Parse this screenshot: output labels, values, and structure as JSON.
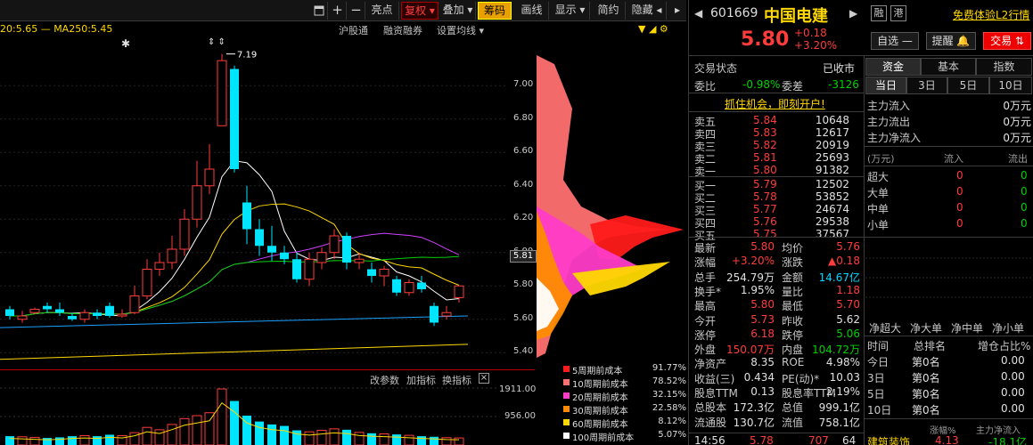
{
  "toolbar": {
    "items": [
      "亮点",
      "复权 ▾",
      "叠加 ▾",
      "筹码",
      "画线",
      "显示 ▾",
      "简约",
      "隐藏 ◂"
    ],
    "icons": [
      "window-icon",
      "plus-icon",
      "minus-icon"
    ]
  },
  "ma_text": "20:5.65 — MA250:5.45",
  "subbar": {
    "items": [
      "沪股通",
      "融资融券",
      "设置均线 ▾"
    ]
  },
  "chart_annotation": "7.19",
  "price_axis": {
    "ticks": [
      "7.00",
      "6.80",
      "6.60",
      "6.40",
      "6.20",
      "6.00",
      "5.80",
      "5.60",
      "5.40"
    ],
    "current": "5.81"
  },
  "indicator_bar": {
    "items": [
      "改参数",
      "加指标",
      "换指标"
    ]
  },
  "volume_axis": {
    "ticks": [
      "1911.00",
      "956.00"
    ]
  },
  "chip_legend": [
    {
      "label": "5周期前成本",
      "value": "91.77%",
      "color": "#ff1a1a"
    },
    {
      "label": "10周期前成本",
      "value": "78.52%",
      "color": "#ff7070"
    },
    {
      "label": "20周期前成本",
      "value": "32.15%",
      "color": "#ff3cc8"
    },
    {
      "label": "30周期前成本",
      "value": "22.58%",
      "color": "#ff8c00"
    },
    {
      "label": "60周期前成本",
      "value": "8.12%",
      "color": "#ffd800"
    },
    {
      "label": "100周期前成本",
      "value": "5.07%",
      "color": "#ffffff"
    }
  ],
  "chart_data": {
    "type": "candlestick",
    "candles": [
      {
        "o": 5.66,
        "c": 5.62,
        "h": 5.68,
        "l": 5.6
      },
      {
        "o": 5.6,
        "c": 5.62,
        "h": 5.65,
        "l": 5.58
      },
      {
        "o": 5.64,
        "c": 5.66,
        "h": 5.67,
        "l": 5.63
      },
      {
        "o": 5.68,
        "c": 5.66,
        "h": 5.7,
        "l": 5.64
      },
      {
        "o": 5.66,
        "c": 5.64,
        "h": 5.7,
        "l": 5.62
      },
      {
        "o": 5.62,
        "c": 5.6,
        "h": 5.64,
        "l": 5.59
      },
      {
        "o": 5.6,
        "c": 5.64,
        "h": 5.66,
        "l": 5.58
      },
      {
        "o": 5.64,
        "c": 5.62,
        "h": 5.66,
        "l": 5.6
      },
      {
        "o": 5.68,
        "c": 5.62,
        "h": 5.7,
        "l": 5.61
      },
      {
        "o": 5.62,
        "c": 5.63,
        "h": 5.66,
        "l": 5.61
      },
      {
        "o": 5.64,
        "c": 5.74,
        "h": 5.8,
        "l": 5.63
      },
      {
        "o": 5.74,
        "c": 5.9,
        "h": 5.96,
        "l": 5.72
      },
      {
        "o": 5.9,
        "c": 5.94,
        "h": 6.0,
        "l": 5.86
      },
      {
        "o": 5.94,
        "c": 6.02,
        "h": 6.1,
        "l": 5.9
      },
      {
        "o": 6.02,
        "c": 6.2,
        "h": 6.26,
        "l": 5.98
      },
      {
        "o": 6.2,
        "c": 6.4,
        "h": 6.55,
        "l": 6.15
      },
      {
        "o": 6.4,
        "c": 6.5,
        "h": 6.65,
        "l": 6.35
      },
      {
        "o": 6.76,
        "c": 7.15,
        "h": 7.19,
        "l": 6.76
      },
      {
        "o": 7.1,
        "c": 6.5,
        "h": 7.12,
        "l": 6.48
      },
      {
        "o": 6.3,
        "c": 6.14,
        "h": 6.4,
        "l": 6.05
      },
      {
        "o": 6.14,
        "c": 6.04,
        "h": 6.2,
        "l": 5.98
      },
      {
        "o": 6.04,
        "c": 6.0,
        "h": 6.16,
        "l": 5.95
      },
      {
        "o": 6.0,
        "c": 5.96,
        "h": 6.04,
        "l": 5.93
      },
      {
        "o": 5.96,
        "c": 5.84,
        "h": 6.0,
        "l": 5.82
      },
      {
        "o": 5.84,
        "c": 5.96,
        "h": 6.0,
        "l": 5.8
      },
      {
        "o": 5.94,
        "c": 6.0,
        "h": 6.03,
        "l": 5.9
      },
      {
        "o": 6.0,
        "c": 6.1,
        "h": 6.14,
        "l": 5.96
      },
      {
        "o": 6.1,
        "c": 5.94,
        "h": 6.12,
        "l": 5.9
      },
      {
        "o": 5.94,
        "c": 5.96,
        "h": 6.0,
        "l": 5.9
      },
      {
        "o": 5.9,
        "c": 5.86,
        "h": 5.94,
        "l": 5.82
      },
      {
        "o": 5.86,
        "c": 5.9,
        "h": 5.92,
        "l": 5.8
      },
      {
        "o": 5.84,
        "c": 5.76,
        "h": 5.86,
        "l": 5.74
      },
      {
        "o": 5.76,
        "c": 5.82,
        "h": 5.84,
        "l": 5.74
      },
      {
        "o": 5.82,
        "c": 5.78,
        "h": 5.86,
        "l": 5.76
      },
      {
        "o": 5.68,
        "c": 5.58,
        "h": 5.7,
        "l": 5.56
      },
      {
        "o": 5.62,
        "c": 5.64,
        "h": 5.68,
        "l": 5.6
      },
      {
        "o": 5.73,
        "c": 5.8,
        "h": 5.8,
        "l": 5.7
      }
    ],
    "volume": [
      300,
      280,
      260,
      240,
      260,
      300,
      320,
      300,
      350,
      320,
      420,
      600,
      520,
      700,
      900,
      1000,
      1100,
      1911,
      1500,
      1000,
      800,
      700,
      650,
      500,
      450,
      500,
      550,
      520,
      430,
      400,
      380,
      360,
      330,
      300,
      280,
      250,
      240
    ],
    "ylim": [
      5.3,
      7.3
    ]
  },
  "quote": {
    "code": "601669",
    "name": "中国电建",
    "tags": [
      "融",
      "港"
    ],
    "promo": "免费体验L2行情",
    "price": "5.80",
    "change": "+0.18",
    "pct": "+3.20%",
    "watch_btn": "自选 —",
    "alert_btn": "提醒 🔔",
    "trade_btn": "交易 ⇅"
  },
  "status": {
    "label": "交易状态",
    "value": "已收市"
  },
  "ratio": {
    "wb_label": "委比",
    "wb": "-0.98%",
    "wc_label": "委差",
    "wc": "-3126"
  },
  "banner": "抓住机会，即刻开户!",
  "asks": [
    {
      "label": "卖五",
      "price": "5.84",
      "vol": "10648"
    },
    {
      "label": "卖四",
      "price": "5.83",
      "vol": "12617"
    },
    {
      "label": "卖三",
      "price": "5.82",
      "vol": "20919"
    },
    {
      "label": "卖二",
      "price": "5.81",
      "vol": "25693"
    },
    {
      "label": "卖一",
      "price": "5.80",
      "vol": "91382"
    }
  ],
  "bids": [
    {
      "label": "买一",
      "price": "5.79",
      "vol": "12502"
    },
    {
      "label": "买二",
      "price": "5.78",
      "vol": "53852"
    },
    {
      "label": "买三",
      "price": "5.77",
      "vol": "24674"
    },
    {
      "label": "买四",
      "price": "5.76",
      "vol": "29538"
    },
    {
      "label": "买五",
      "price": "5.75",
      "vol": "37567"
    }
  ],
  "stats": [
    {
      "l1": "最新",
      "v1": "5.80",
      "c1": "red",
      "l2": "均价",
      "v2": "5.76",
      "c2": "red"
    },
    {
      "l1": "涨幅",
      "v1": "+3.20%",
      "c1": "red",
      "l2": "涨跌",
      "v2": "▲0.18",
      "c2": "red"
    },
    {
      "l1": "总手",
      "v1": "254.79万",
      "c1": "white",
      "l2": "金额",
      "v2": "14.67亿",
      "c2": "cyan"
    },
    {
      "l1": "换手*",
      "v1": "1.95%",
      "c1": "white",
      "l2": "量比",
      "v2": "1.18",
      "c2": "red"
    },
    {
      "l1": "最高",
      "v1": "5.80",
      "c1": "red",
      "l2": "最低",
      "v2": "5.70",
      "c2": "red"
    },
    {
      "l1": "今开",
      "v1": "5.73",
      "c1": "red",
      "l2": "昨收",
      "v2": "5.62",
      "c2": "white"
    },
    {
      "l1": "涨停",
      "v1": "6.18",
      "c1": "red",
      "l2": "跌停",
      "v2": "5.06",
      "c2": "green"
    },
    {
      "l1": "外盘",
      "v1": "150.07万",
      "c1": "red",
      "l2": "内盘",
      "v2": "104.72万",
      "c2": "green"
    },
    {
      "l1": "净资产",
      "v1": "8.35",
      "c1": "white",
      "l2": "ROE",
      "v2": "4.98%",
      "c2": "white"
    },
    {
      "l1": "收益(三)",
      "v1": "0.434",
      "c1": "white",
      "l2": "PE(动)*",
      "v2": "10.03",
      "c2": "white"
    },
    {
      "l1": "股息TTM",
      "v1": "0.13",
      "c1": "white",
      "l2": "股息率TTM",
      "v2": "2.19%",
      "c2": "white"
    },
    {
      "l1": "总股本",
      "v1": "172.3亿",
      "c1": "white",
      "l2": "总值",
      "v2": "999.1亿",
      "c2": "white"
    },
    {
      "l1": "流通股",
      "v1": "130.7亿",
      "c1": "white",
      "l2": "流值",
      "v2": "758.1亿",
      "c2": "white"
    }
  ],
  "tick": {
    "time": "14:56",
    "price": "5.78",
    "vol": "707",
    "num": "64"
  },
  "fund": {
    "tabs": [
      "资金",
      "基本",
      "指数"
    ],
    "day_tabs": [
      "当日",
      "3日",
      "5日",
      "10日"
    ],
    "flows": [
      {
        "label": "主力流入",
        "value": "0万元"
      },
      {
        "label": "主力流出",
        "value": "0万元"
      },
      {
        "label": "主力净流入",
        "value": "0万元"
      }
    ],
    "table_head": [
      "(万元)",
      "流入",
      "流出"
    ],
    "rows": [
      {
        "label": "超大",
        "in": "0",
        "out": "0"
      },
      {
        "label": "大单",
        "in": "0",
        "out": "0"
      },
      {
        "label": "中单",
        "in": "0",
        "out": "0"
      },
      {
        "label": "小单",
        "in": "0",
        "out": "0"
      }
    ],
    "net_tabs": [
      "净超大",
      "净大单",
      "净中单",
      "净小单"
    ],
    "rank_head": [
      "时间",
      "总排名",
      "增仓占比%"
    ],
    "ranks": [
      {
        "t": "今日",
        "r": "第0名",
        "v": "0.00"
      },
      {
        "t": "3日",
        "r": "第0名",
        "v": "0.00"
      },
      {
        "t": "5日",
        "r": "第0名",
        "v": "0.00"
      },
      {
        "t": "10日",
        "r": "第0名",
        "v": "0.00"
      }
    ],
    "bottom": {
      "a": "建筑装饰",
      "b": "涨幅%",
      "c": "主力净流入",
      "d": "4.13",
      "e": "-18.1亿"
    }
  }
}
